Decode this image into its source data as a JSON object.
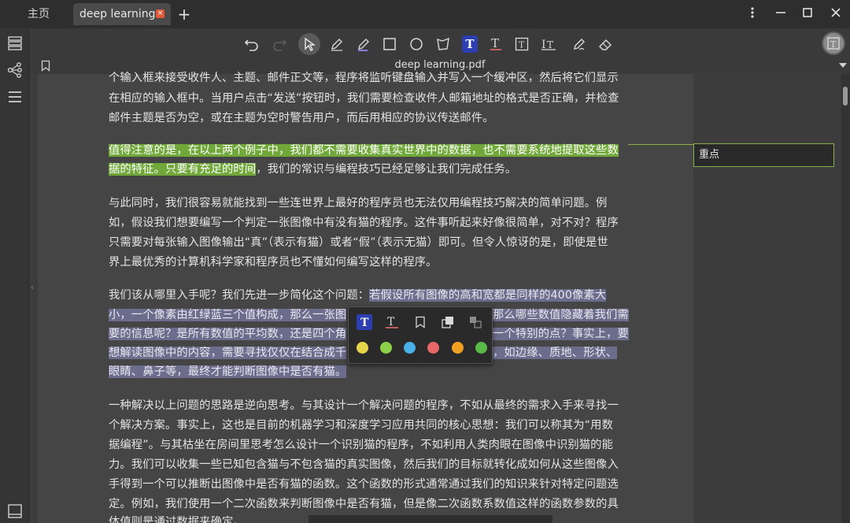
{
  "tabs": {
    "home_label": "主页",
    "active_label": "deep learning",
    "add_label": "+"
  },
  "document": {
    "title": "deep learning.pdf"
  },
  "note": {
    "text": "重点"
  },
  "paragraphs": {
    "p1": [
      "个输入框来接受收件人、主题、邮件正文等，程序将监听键盘输入并写入一个缓冲区，然后将它们显示",
      "在相应的输入框中。当用户点击“发送”按钮时，我们需要检查收件人邮箱地址的格式是否正确，并检查",
      "邮件主题是否为空，或在主题为空时警告用户，而后用相应的协议传送邮件。"
    ],
    "p2_line1": "值得注意的是，在以上两个例子中，我们都不需要收集真实世界中的数据，也不需要系统地提取这些数",
    "p2_line2_hl": "据的特征。只要有充足的时间",
    "p2_line2_rest": "，我们的常识与编程技巧已经足够让我们完成任务。",
    "p3": [
      "与此同时，我们很容易就能找到一些连世界上最好的程序员也无法仅用编程技巧解决的简单问题。例",
      "如，假设我们想要编写一个判定一张图像中有没有猫的程序。这件事听起来好像很简单，对不对？程序",
      "只需要对每张输入图像输出“真”（表示有猫）或者“假”（表示无猫）即可。但令人惊讶的是，即使是世",
      "界上最优秀的计算机科学家和程序员也不懂如何编写这样的程序。"
    ],
    "p4_line1_plain": "我们该从哪里入手呢？我们先进一步简化这个问题：",
    "p4_line1_hl": "若假设所有图像的高和宽都是同样的400像素大",
    "p4_line2_left": "小，一个像素由红绿蓝三个值构成，那么一张图",
    "p4_line2_right": "那么哪些数值隐藏着我们需",
    "p4_line3_left": "要的信息呢？是所有数值的平均数，还是四个角",
    "p4_line3_right": "一个特别的点？事实上，要",
    "p4_line4_left": "想解读图像中的内容，需要寻找仅仅在结合成千",
    "p4_line4_right": "，如边缘、质地、形状、",
    "p4_line5": "眼睛、鼻子等，最终才能判断图像中是否有猫。",
    "p5": [
      "一种解决以上问题的思路是逆向思考。与其设计一个解决问题的程序，不如从最终的需求入手来寻找一",
      "个解决方案。事实上，这也是目前的机器学习和深度学习应用共同的核心思想：我们可以称其为“用数",
      "据编程”。与其枯坐在房间里思考怎么设计一个识别猫的程序，不如利用人类肉眼在图像中识别猫的能",
      "力。我们可以收集一些已知包含猫与不包含猫的真实图像，然后我们的目标就转化成如何从这些图像入",
      "手得到一个可以推断出图像中是否有猫的函数。这个函数的形式通常通过我们的知识来针对特定问题选",
      "定。例如，我们使用一个二次函数来判断图像中是否有猫，但是像二次函数系数值这样的函数参数的具",
      "体值则是通过数据来确定。"
    ]
  },
  "popup": {
    "colors": [
      "#e8d44a",
      "#8cd04a",
      "#4ab0e8",
      "#e86868",
      "#f0a020",
      "#58b848"
    ]
  },
  "colors": {
    "highlight_green": "#70a83a",
    "highlight_purple": "#6c6c8c",
    "accent_blue": "#2d3fb0",
    "close_red": "#e05a3a"
  }
}
